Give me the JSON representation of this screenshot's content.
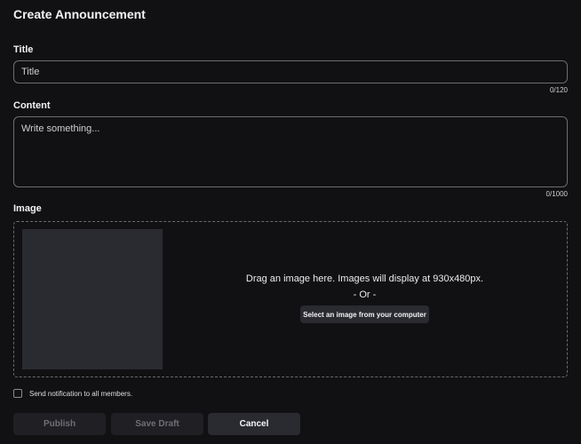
{
  "page": {
    "heading": "Create Announcement"
  },
  "title_field": {
    "label": "Title",
    "placeholder": "Title",
    "value": "",
    "counter": "0/120"
  },
  "content_field": {
    "label": "Content",
    "placeholder": "Write something...",
    "value": "",
    "counter": "0/1000"
  },
  "image_field": {
    "label": "Image",
    "drop_text": "Drag an image here. Images will display at 930x480px.",
    "or_text": "- Or -",
    "select_button": "Select an image from your computer"
  },
  "notification": {
    "label": "Send notification to all members.",
    "checked": false
  },
  "actions": {
    "publish": "Publish",
    "save_draft": "Save Draft",
    "cancel": "Cancel"
  },
  "colors": {
    "background": "#111113",
    "surface": "#2a2a31",
    "border": "#6d6d73",
    "disabled_text": "#6f6f76"
  }
}
